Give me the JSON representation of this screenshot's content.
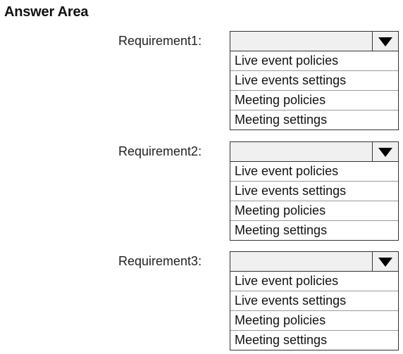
{
  "page": {
    "title": "Answer Area"
  },
  "requirements": [
    {
      "label": "Requirement1:",
      "selected": "",
      "dropdown_icon": "triangle-down-icon",
      "options": [
        "Live event policies",
        "Live events settings",
        "Meeting policies",
        "Meeting settings"
      ]
    },
    {
      "label": "Requirement2:",
      "selected": "",
      "dropdown_icon": "triangle-down-icon",
      "options": [
        "Live event policies",
        "Live events settings",
        "Meeting policies",
        "Meeting settings"
      ]
    },
    {
      "label": "Requirement3:",
      "selected": "",
      "dropdown_icon": "triangle-down-icon",
      "options": [
        "Live event policies",
        "Live events settings",
        "Meeting policies",
        "Meeting settings"
      ]
    }
  ],
  "colors": {
    "header_bg": "#f0f0f0",
    "border": "#333333",
    "option_divider": "#9a9a9a",
    "arrow": "#000000"
  }
}
